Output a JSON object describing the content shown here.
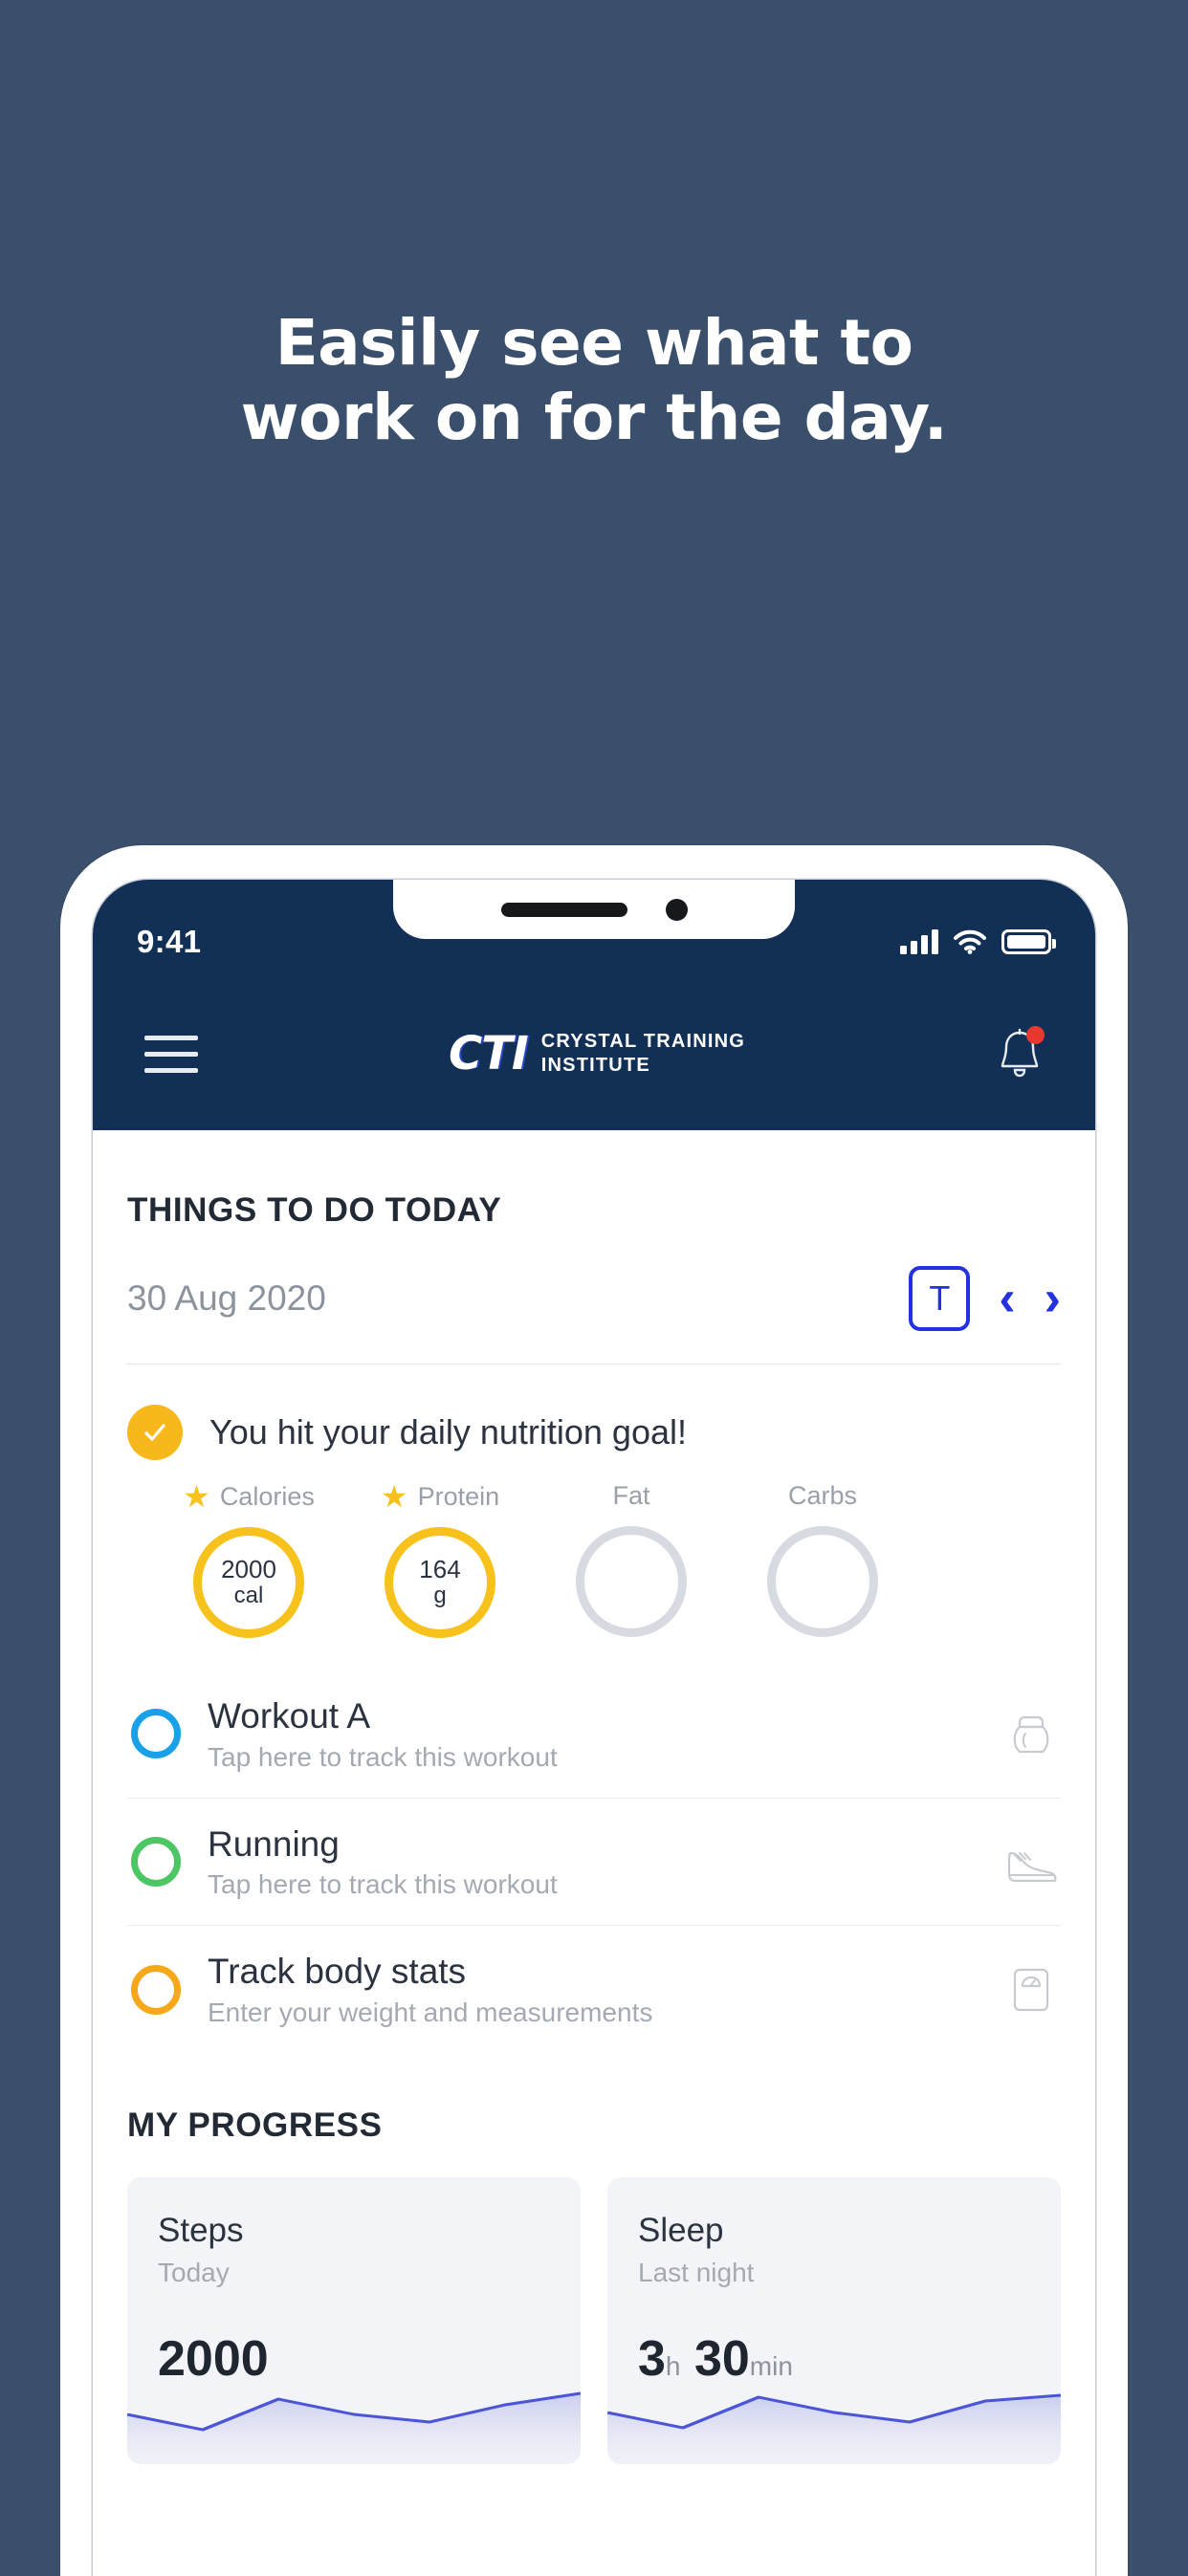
{
  "promo": {
    "headline_line1": "Easily see what to",
    "headline_line2": "work on for the day.",
    "background_color": "#3a4f6b"
  },
  "phone": {
    "status_bar": {
      "time": "9:41",
      "signal_icon": "cellular-bars-icon",
      "wifi_icon": "wifi-icon",
      "battery_icon": "battery-icon"
    },
    "app_bar": {
      "menu_icon": "hamburger-menu-icon",
      "logo_mark": "CTI",
      "logo_line1": "CRYSTAL TRAINING",
      "logo_line2": "INSTITUTE",
      "notification_icon": "bell-icon",
      "notification_badge": true,
      "background_color": "#123055"
    },
    "todo": {
      "section_title": "THINGS TO DO TODAY",
      "date": "30 Aug 2020",
      "today_button_label": "T",
      "prev_icon": "chevron-left-icon",
      "next_icon": "chevron-right-icon",
      "accent_color": "#2331e0",
      "nutrition": {
        "check_icon": "check-icon",
        "message": "You hit your daily nutrition goal!",
        "macros": [
          {
            "label": "Calories",
            "starred": true,
            "value": "2000",
            "unit": "cal",
            "filled": true
          },
          {
            "label": "Protein",
            "starred": true,
            "value": "164",
            "unit": "g",
            "filled": true
          },
          {
            "label": "Fat",
            "starred": false,
            "value": "",
            "unit": "",
            "filled": false
          },
          {
            "label": "Carbs",
            "starred": false,
            "value": "",
            "unit": "",
            "filled": false
          }
        ]
      },
      "tasks": [
        {
          "title": "Workout A",
          "subtitle": "Tap here to track this workout",
          "ring_color": "#18a0e8",
          "icon": "kettlebell-icon"
        },
        {
          "title": "Running",
          "subtitle": "Tap here to track this workout",
          "ring_color": "#4cc764",
          "icon": "running-shoe-icon"
        },
        {
          "title": "Track body stats",
          "subtitle": "Enter your weight and measurements",
          "ring_color": "#f6a81a",
          "icon": "weight-scale-icon"
        }
      ]
    },
    "progress": {
      "section_title": "MY PROGRESS",
      "cards": [
        {
          "title": "Steps",
          "subtitle": "Today",
          "value": "2000",
          "unit": "",
          "value2": "",
          "unit2": ""
        },
        {
          "title": "Sleep",
          "subtitle": "Last night",
          "value": "3",
          "unit": "h",
          "value2": "30",
          "unit2": "min"
        }
      ]
    }
  },
  "chart_data": [
    {
      "type": "area",
      "title": "Steps",
      "x": [
        0,
        1,
        2,
        3,
        4,
        5,
        6
      ],
      "values": [
        52,
        36,
        68,
        52,
        44,
        62,
        74
      ],
      "ylim": [
        0,
        96
      ],
      "line_color": "#4b55d6",
      "fill_color": "#c8ccee",
      "grid": false,
      "xlabel": "",
      "ylabel": ""
    },
    {
      "type": "area",
      "title": "Sleep",
      "x": [
        0,
        1,
        2,
        3,
        4,
        5,
        6
      ],
      "values": [
        54,
        38,
        70,
        54,
        44,
        66,
        72
      ],
      "ylim": [
        0,
        96
      ],
      "line_color": "#4b55d6",
      "fill_color": "#c8ccee",
      "grid": false,
      "xlabel": "",
      "ylabel": ""
    }
  ]
}
